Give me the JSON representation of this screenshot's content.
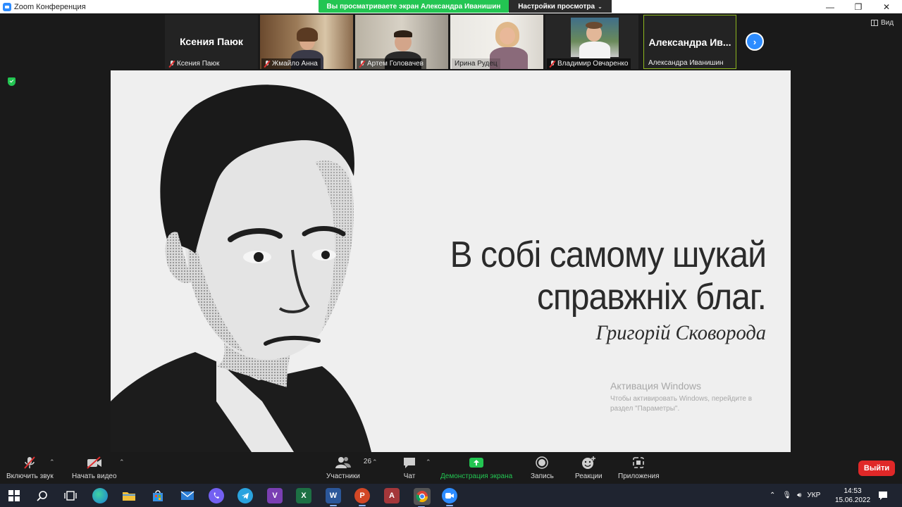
{
  "window": {
    "title": "Zoom Конференция"
  },
  "banner": {
    "viewing": "Вы просматриваете экран Александра Иванишин",
    "settings": "Настройки просмотра"
  },
  "view_label": "Вид",
  "participants": [
    {
      "big": "Ксения Паюк",
      "label": "Ксения Паюк",
      "muted": true
    },
    {
      "big": "",
      "label": "Жмайло Анна",
      "muted": true
    },
    {
      "big": "",
      "label": "Артем Головачев",
      "muted": true
    },
    {
      "big": "",
      "label": "Ирина Рудец",
      "muted": false
    },
    {
      "big": "",
      "label": "Владимир Овчаренко",
      "muted": true
    },
    {
      "big": "Александра Ив...",
      "label": "Александра Иванишин",
      "muted": false
    }
  ],
  "slide": {
    "line1": "В собі самому шукай",
    "line2": "справжніх благ.",
    "author": "Григорій Сковорода"
  },
  "activation": {
    "title": "Активация Windows",
    "text": "Чтобы активировать Windows, перейдите в раздел \"Параметры\"."
  },
  "toolbar": {
    "audio": "Включить звук",
    "video": "Начать видео",
    "participants": "Участники",
    "participants_count": "26",
    "chat": "Чат",
    "share": "Демонстрация экрана",
    "record": "Запись",
    "reactions": "Реакции",
    "apps": "Приложения",
    "exit": "Выйти"
  },
  "taskbar": {
    "lang": "УКР",
    "time": "14:53",
    "date": "15.06.2022",
    "word_letter": "W",
    "excel_letter": "X",
    "ppt_letter": "P",
    "access_letter": "A",
    "vs_letter": "V"
  },
  "colors": {
    "zoom_blue": "#2d8cff",
    "share_green": "#23c552",
    "exit_red": "#e02828"
  }
}
